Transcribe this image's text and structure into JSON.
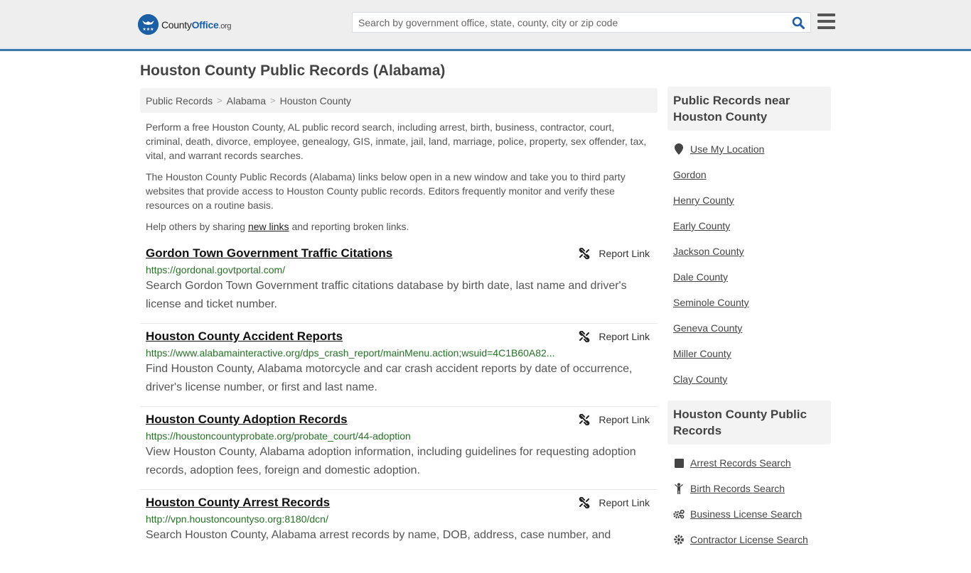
{
  "header": {
    "logo": {
      "name": "County",
      "highlight": "Office",
      "tld": ".org"
    },
    "search_placeholder": "Search by government office, state, county, city or zip code",
    "search_value": ""
  },
  "page_title": "Houston County Public Records (Alabama)",
  "breadcrumb": [
    "Public Records",
    "Alabama",
    "Houston County"
  ],
  "intro": {
    "p1": "Perform a free Houston County, AL public record search, including arrest, birth, business, contractor, court, criminal, death, divorce, employee, genealogy, GIS, inmate, jail, land, marriage, police, property, sex offender, tax, vital, and warrant records searches.",
    "p2": "The Houston County Public Records (Alabama) links below open in a new window and take you to third party websites that provide access to Houston County public records. Editors frequently monitor and verify these resources on a routine basis.",
    "p3_before": "Help others by sharing ",
    "p3_link": "new links",
    "p3_after": " and reporting broken links."
  },
  "report_label": "Report Link",
  "records": [
    {
      "title": "Gordon Town Government Traffic Citations",
      "url": "https://gordonal.govtportal.com/",
      "desc": "Search Gordon Town Government traffic citations database by birth date, last name and driver's license and ticket number."
    },
    {
      "title": "Houston County Accident Reports",
      "url": "https://www.alabamainteractive.org/dps_crash_report/mainMenu.action;wsuid=4C1B60A82...",
      "desc": "Find Houston County, Alabama motorcycle and car crash accident reports by date of occurrence, driver's license number, or first and last name."
    },
    {
      "title": "Houston County Adoption Records",
      "url": "https://houstoncountyprobate.org/probate_court/44-adoption",
      "desc": "View Houston County, Alabama adoption information, including guidelines for requesting adoption records, adoption fees, foreign and domestic adoption."
    },
    {
      "title": "Houston County Arrest Records",
      "url": "http://vpn.houstoncountyso.org:8180/dcn/",
      "desc": "Search Houston County, Alabama arrest records by name, DOB, address, case number, and"
    }
  ],
  "sidebar": {
    "nearby_title": "Public Records near Houston County",
    "use_location": "Use My Location",
    "nearby": [
      "Gordon",
      "Henry County",
      "Early County",
      "Jackson County",
      "Dale County",
      "Seminole County",
      "Geneva County",
      "Miller County",
      "Clay County"
    ],
    "county_title": "Houston County Public Records",
    "county_links": [
      {
        "label": "Arrest Records Search",
        "icon": "square-icon"
      },
      {
        "label": "Birth Records Search",
        "icon": "child-icon"
      },
      {
        "label": "Business License Search",
        "icon": "cogs-icon"
      },
      {
        "label": "Contractor License Search",
        "icon": "gear-icon"
      }
    ]
  },
  "colors": {
    "accent": "#1d5fa5",
    "header_border": "#3a79a8",
    "url_green": "#267326"
  }
}
